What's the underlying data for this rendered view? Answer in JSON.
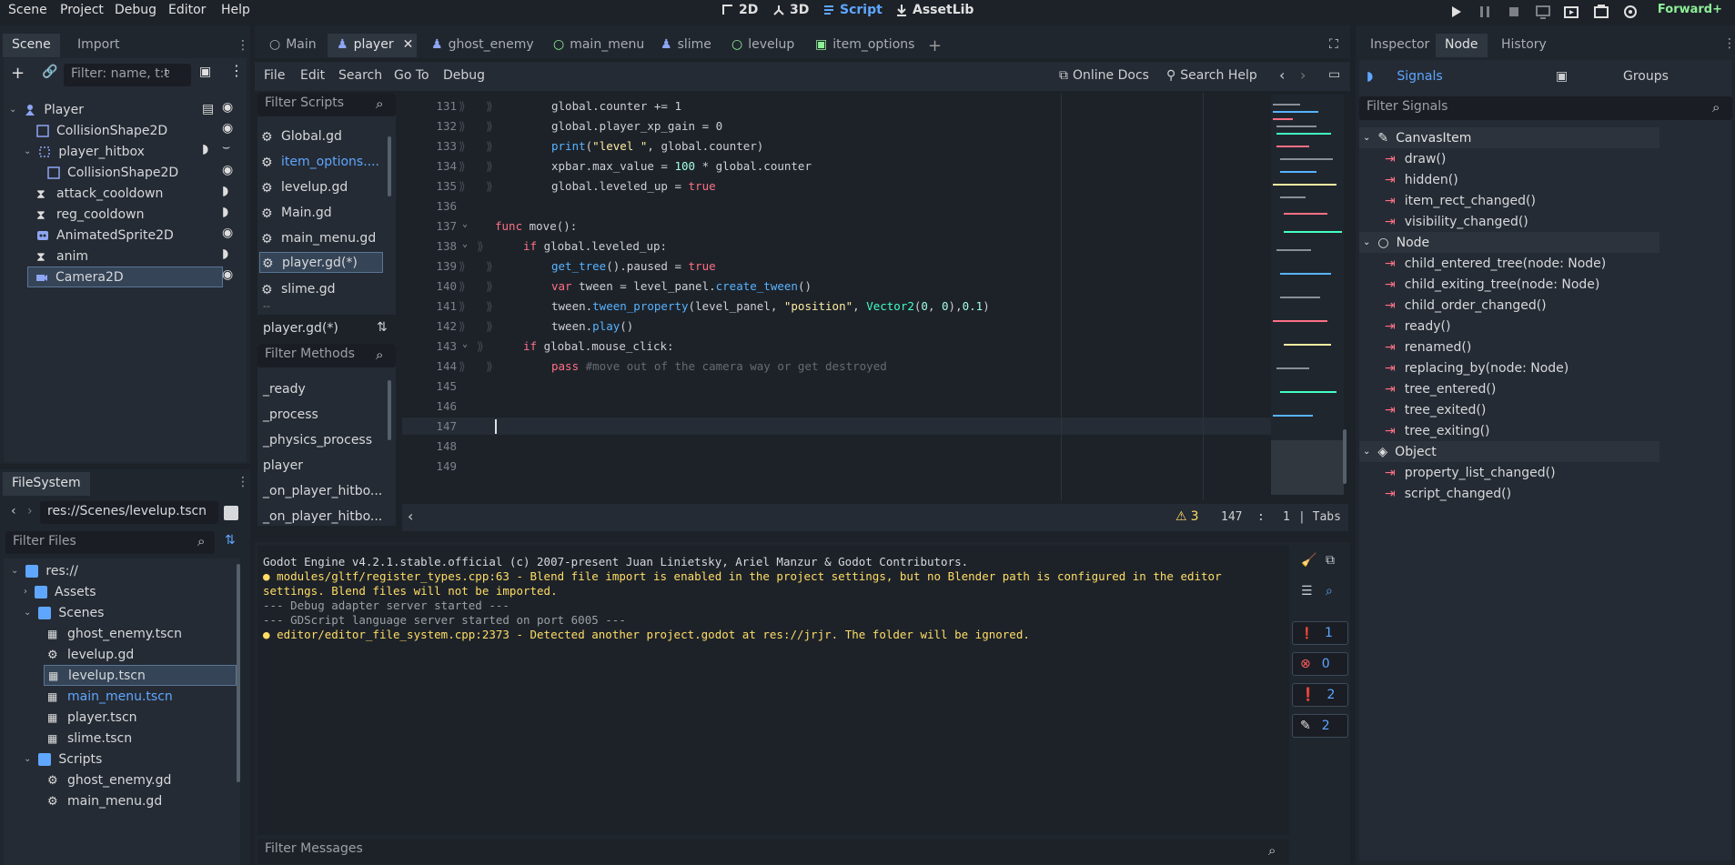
{
  "menubar": {
    "items": [
      "Scene",
      "Project",
      "Debug",
      "Editor",
      "Help"
    ]
  },
  "modes": [
    {
      "label": "2D",
      "icon": "2d-icon",
      "active": false
    },
    {
      "label": "3D",
      "icon": "3d-icon",
      "active": false
    },
    {
      "label": "Script",
      "icon": "script-icon",
      "active": true
    },
    {
      "label": "AssetLib",
      "icon": "assetlib-icon",
      "active": false
    }
  ],
  "renderer": "Forward+",
  "scene_dock": {
    "tabs": [
      "Scene",
      "Import"
    ],
    "filter_placeholder": "Filter: name, t:t",
    "tree": [
      {
        "label": "Player",
        "icon": "character-icon"
      },
      {
        "label": "CollisionShape2D",
        "icon": "collision-icon"
      },
      {
        "label": "player_hitbox",
        "icon": "area-icon"
      },
      {
        "label": "CollisionShape2D",
        "icon": "collision-icon"
      },
      {
        "label": "attack_cooldown",
        "icon": "timer-icon"
      },
      {
        "label": "reg_cooldown",
        "icon": "timer-icon"
      },
      {
        "label": "AnimatedSprite2D",
        "icon": "sprite-icon"
      },
      {
        "label": "anim",
        "icon": "timer-icon"
      },
      {
        "label": "Camera2D",
        "icon": "camera-icon"
      }
    ]
  },
  "filesystem": {
    "tab": "FileSystem",
    "path": "res://Scenes/levelup.tscn",
    "filter_placeholder": "Filter Files",
    "tree": [
      {
        "label": "res://"
      },
      {
        "label": "Assets"
      },
      {
        "label": "Scenes"
      },
      {
        "label": "ghost_enemy.tscn"
      },
      {
        "label": "levelup.gd"
      },
      {
        "label": "levelup.tscn"
      },
      {
        "label": "main_menu.tscn"
      },
      {
        "label": "player.tscn"
      },
      {
        "label": "slime.tscn"
      },
      {
        "label": "Scripts"
      },
      {
        "label": "ghost_enemy.gd"
      },
      {
        "label": "main_menu.gd"
      }
    ]
  },
  "editor_tabs": [
    "Main",
    "player",
    "ghost_enemy",
    "main_menu",
    "slime",
    "levelup",
    "item_options"
  ],
  "script_menu": [
    "File",
    "Edit",
    "Search",
    "Go To",
    "Debug"
  ],
  "script_toolbar": {
    "online_docs": "Online Docs",
    "search_help": "Search Help"
  },
  "scripts_panel": {
    "filter_placeholder": "Filter Scripts",
    "items": [
      "Global.gd",
      "item_options....",
      "levelup.gd",
      "Main.gd",
      "main_menu.gd",
      "player.gd(*)",
      "slime.gd",
      "--"
    ],
    "current_file": "player.gd(*)",
    "methods_placeholder": "Filter Methods",
    "methods": [
      "_ready",
      "_process",
      "_physics_process",
      "player",
      "_on_player_hitbo...",
      "_on_player_hitbo..."
    ]
  },
  "code": {
    "line_numbers": [
      "131",
      "132",
      "133",
      "134",
      "135",
      "136",
      "137",
      "138",
      "139",
      "140",
      "141",
      "142",
      "143",
      "144",
      "145",
      "146",
      "147",
      "148",
      "149"
    ],
    "l131": "global.counter += 1",
    "l132": "global.player_xp_gain = 0",
    "l133_fn": "print",
    "l133_a": "(",
    "l133_str": "\"level \"",
    "l133_b": ", global.counter)",
    "l134_a": "xpbar.max_value = ",
    "l134_num": "100",
    "l134_b": " * global.counter",
    "l135_a": "global.leveled_up = ",
    "l135_kw": "true",
    "l137_kw": "func",
    "l137_a": " move():",
    "l138_kw": "if",
    "l138_a": " global.leveled_up:",
    "l139_fn": "get_tree",
    "l139_a": "().paused = ",
    "l139_kw": "true",
    "l140_kw": "var",
    "l140_a": " tween = level_panel.",
    "l140_fn": "create_tween",
    "l140_b": "()",
    "l141_a": "tween.",
    "l141_fn": "tween_property",
    "l141_b": "(level_panel, ",
    "l141_str": "\"position\"",
    "l141_c": ", ",
    "l141_ty": "Vector2",
    "l141_d": "(",
    "l141_n1": "0",
    "l141_e": ", ",
    "l141_n2": "0",
    "l141_f": "),",
    "l141_n3": "0.1",
    "l141_g": ")",
    "l142_a": "tween.",
    "l142_fn": "play",
    "l142_b": "()",
    "l143_kw": "if",
    "l143_a": " global.mouse_click:",
    "l144_kw": "pass",
    "l144_cm": " #move out of the camera way or get destroyed"
  },
  "status": {
    "warnings": "3",
    "line": "147",
    "col_sep": ":",
    "col": "1",
    "indent": "| Tabs"
  },
  "output": {
    "lines": [
      "Godot Engine v4.2.1.stable.official (c) 2007-present Juan Linietsky, Ariel Manzur & Godot Contributors.",
      "modules/gltf/register_types.cpp:63 - Blend file import is enabled in the project settings, but no Blender path is configured in the editor",
      "settings. Blend files will not be imported.",
      "--- Debug adapter server started ---",
      "--- GDScript language server started on port 6005 ---",
      "editor/editor_file_system.cpp:2373 - Detected another project.godot at res://jrjr. The folder will be ignored."
    ],
    "filter_placeholder": "Filter Messages",
    "counts": [
      "1",
      "0",
      "2",
      "2"
    ]
  },
  "inspector": {
    "tabs": [
      "Inspector",
      "Node",
      "History"
    ],
    "subtabs": {
      "signals": "Signals",
      "groups": "Groups"
    },
    "filter_placeholder": "Filter Signals",
    "categories": [
      {
        "name": "CanvasItem",
        "signals": [
          "draw()",
          "hidden()",
          "item_rect_changed()",
          "visibility_changed()"
        ]
      },
      {
        "name": "Node",
        "signals": [
          "child_entered_tree(node: Node)",
          "child_exiting_tree(node: Node)",
          "child_order_changed()",
          "ready()",
          "renamed()",
          "replacing_by(node: Node)",
          "tree_entered()",
          "tree_exited()",
          "tree_exiting()"
        ]
      },
      {
        "name": "Object",
        "signals": [
          "property_list_changed()",
          "script_changed()"
        ]
      }
    ]
  },
  "colors": {
    "accent": "#5fa6ff",
    "warning": "#ffdd65",
    "error": "#ff5d5d",
    "keyword": "#ff7085",
    "renderer": "#8eef97"
  }
}
